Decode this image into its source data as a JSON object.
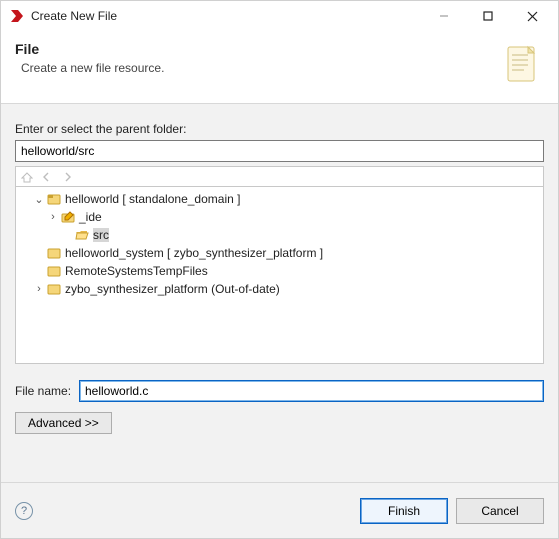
{
  "window": {
    "title": "Create New File"
  },
  "header": {
    "heading": "File",
    "subtitle": "Create a new file resource."
  },
  "folder_prompt": "Enter or select the parent folder:",
  "folder_path": "helloworld/src",
  "tree": {
    "n0": {
      "label": "helloworld [ standalone_domain ]"
    },
    "n1": {
      "label": "_ide"
    },
    "n2": {
      "label": "src"
    },
    "n3": {
      "label": "helloworld_system [ zybo_synthesizer_platform ]"
    },
    "n4": {
      "label": "RemoteSystemsTempFiles"
    },
    "n5": {
      "label": "zybo_synthesizer_platform (Out-of-date)"
    }
  },
  "filename": {
    "label": "File name:",
    "value": "helloworld.c"
  },
  "advanced_label": "Advanced >>",
  "buttons": {
    "finish": "Finish",
    "cancel": "Cancel"
  }
}
